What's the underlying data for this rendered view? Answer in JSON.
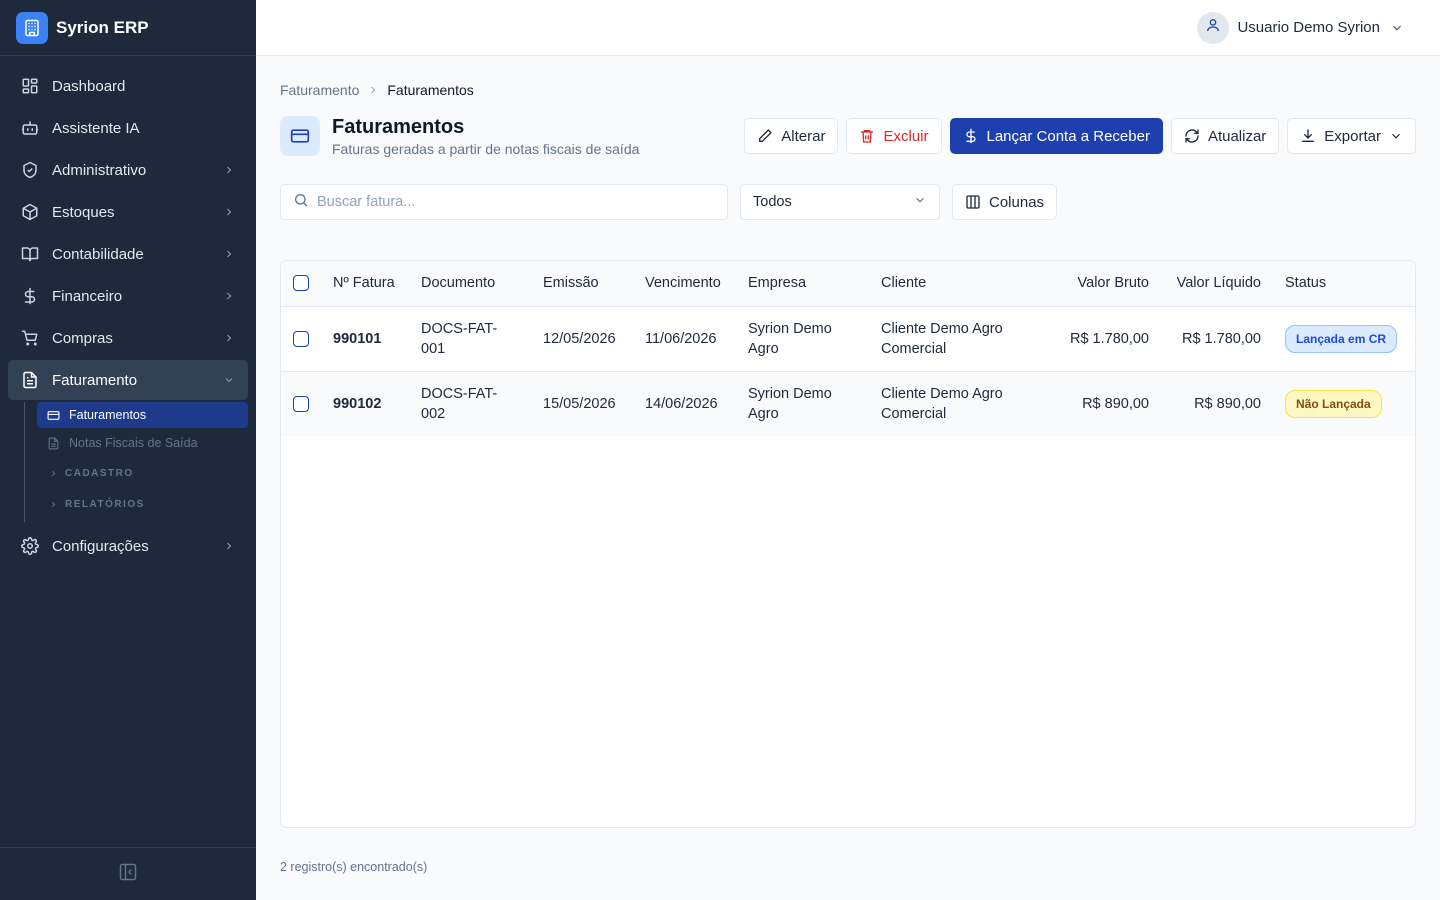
{
  "app": {
    "name": "Syrion ERP"
  },
  "sidebar": {
    "items": [
      {
        "label": "Dashboard",
        "icon": "dashboard-icon"
      },
      {
        "label": "Assistente IA",
        "icon": "bot-icon"
      },
      {
        "label": "Administrativo",
        "icon": "shield-icon"
      },
      {
        "label": "Estoques",
        "icon": "box-icon"
      },
      {
        "label": "Contabilidade",
        "icon": "book-icon"
      },
      {
        "label": "Financeiro",
        "icon": "dollar-icon"
      },
      {
        "label": "Compras",
        "icon": "cart-icon"
      },
      {
        "label": "Faturamento",
        "icon": "document-icon"
      },
      {
        "label": "Configurações",
        "icon": "gear-icon"
      }
    ],
    "faturamento_sub": {
      "items": [
        "Faturamentos",
        "Notas Fiscais de Saída"
      ],
      "groups": [
        "CADASTRO",
        "RELATÓRIOS"
      ]
    }
  },
  "user": {
    "name": "Usuario Demo Syrion"
  },
  "breadcrumb": {
    "parent": "Faturamento",
    "current": "Faturamentos"
  },
  "header": {
    "title": "Faturamentos",
    "subtitle": "Faturas geradas a partir de notas fiscais de saída"
  },
  "actions": {
    "edit": "Alterar",
    "delete": "Excluir",
    "launch": "Lançar Conta a Receber",
    "refresh": "Atualizar",
    "export": "Exportar"
  },
  "filters": {
    "search_placeholder": "Buscar fatura...",
    "status_selected": "Todos",
    "columns_label": "Colunas"
  },
  "table": {
    "columns": [
      "Nº Fatura",
      "Documento",
      "Emissão",
      "Vencimento",
      "Empresa",
      "Cliente",
      "Valor Bruto",
      "Valor Líquido",
      "Status"
    ],
    "rows": [
      {
        "numero": "990101",
        "documento": "DOCS-FAT-001",
        "emissao": "12/05/2026",
        "vencimento": "11/06/2026",
        "empresa": "Syrion Demo Agro",
        "cliente": "Cliente Demo Agro Comercial",
        "valor_bruto": "R$ 1.780,00",
        "valor_liquido": "R$ 1.780,00",
        "status": "Lançada em CR"
      },
      {
        "numero": "990102",
        "documento": "DOCS-FAT-002",
        "emissao": "15/05/2026",
        "vencimento": "14/06/2026",
        "empresa": "Syrion Demo Agro",
        "cliente": "Cliente Demo Agro Comercial",
        "valor_bruto": "R$ 890,00",
        "valor_liquido": "R$ 890,00",
        "status": "Não Lançada"
      }
    ]
  },
  "footer": {
    "count": "2 registro(s) encontrado(s)"
  },
  "colors": {
    "sidebar_bg": "#1e293b",
    "primary": "#1e40af",
    "danger": "#dc2626",
    "badge_blue": "#dbeafe",
    "badge_yellow": "#fef9c3"
  }
}
